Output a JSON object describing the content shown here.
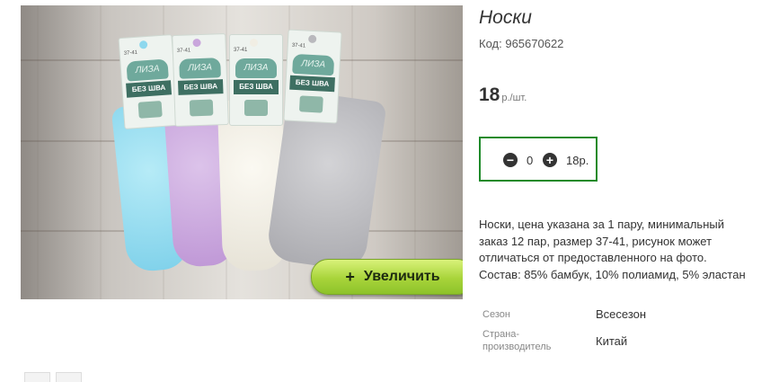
{
  "product": {
    "title": "Носки",
    "code_label": "Код:",
    "code": "965670622",
    "price": "18",
    "price_unit": "р./шт.",
    "zoom_button": {
      "icon": "+",
      "label": "Увеличить"
    },
    "quantity": {
      "minus": "−",
      "plus": "+",
      "value": "0",
      "sum": "18р."
    },
    "description_lines": [
      "Носки, цена указана за 1 пару, минимальный",
      "заказ 12 пар, размер 37-41, рисунок может",
      "отличаться от предоставленного на фото.",
      "Состав: 85% бамбук, 10% полиамид, 5% эластан"
    ],
    "attributes": [
      {
        "label": "Сезон",
        "value": "Всесезон"
      },
      {
        "label": "Страна-\nпроизводитель",
        "value": "Китай"
      }
    ]
  },
  "image_tags": {
    "brand": "ЛИЗА",
    "band": "БЕЗ ШВА",
    "size": "37-41"
  },
  "colors": {
    "accent_green": "#1e8a2a",
    "zoom_button": "#a8d43a",
    "sock_blue": "#8ed8ee",
    "sock_lilac": "#c9a6dc",
    "sock_cream": "#f1eee4",
    "sock_grey": "#b9b9bd"
  }
}
